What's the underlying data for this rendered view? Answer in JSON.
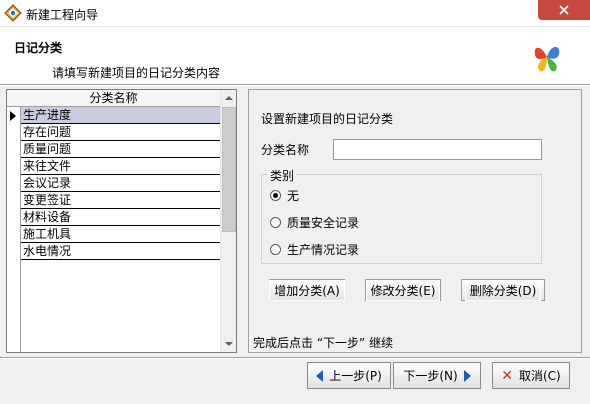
{
  "window": {
    "title": "新建工程向导"
  },
  "header": {
    "title": "日记分类",
    "subtitle": "请填写新建项目的日记分类内容"
  },
  "list": {
    "column_header": "分类名称",
    "items": [
      "生产进度",
      "存在问题",
      "质量问题",
      "来往文件",
      "会议记录",
      "变更签证",
      "材料设备",
      "施工机具",
      "水电情况"
    ],
    "selected_index": 0
  },
  "form": {
    "heading": "设置新建项目的日记分类",
    "name_label": "分类名称",
    "name_value": "",
    "group_label": "类别",
    "radios": [
      {
        "label": "无",
        "checked": true
      },
      {
        "label": "质量安全记录",
        "checked": false
      },
      {
        "label": "生产情况记录",
        "checked": false
      }
    ],
    "buttons": {
      "add": "增加分类(A)",
      "edit": "修改分类(E)",
      "delete": "删除分类(D)"
    },
    "hint": "完成后点击 “下一步” 继续"
  },
  "footer": {
    "prev": "上一步(P)",
    "next": "下一步(N)",
    "cancel": "取消(C)"
  },
  "colors": {
    "close_button": "#c8483d",
    "selected_row": "#c9cce0",
    "nav_arrow": "#1e5bb8"
  },
  "icons": {
    "app": "wizard-app-icon",
    "brand": "butterfly-logo-icon",
    "close": "close-icon"
  }
}
